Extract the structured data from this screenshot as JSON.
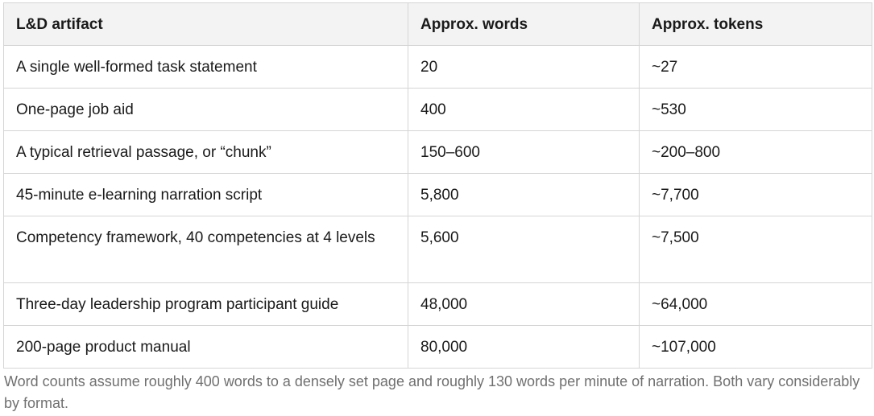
{
  "table": {
    "headers": [
      "L&D artifact",
      "Approx. words",
      "Approx. tokens"
    ],
    "rows": [
      [
        "A single well-formed task statement",
        "20",
        "~27"
      ],
      [
        "One-page job aid",
        "400",
        "~530"
      ],
      [
        "A typical retrieval passage, or “chunk”",
        "150–600",
        "~200–800"
      ],
      [
        "45-minute e-learning narration script",
        "5,800",
        "~7,700"
      ],
      [
        "Competency framework, 40 competencies at 4 levels",
        "5,600",
        "~7,500"
      ],
      [
        "Three-day leadership program participant guide",
        "48,000",
        "~64,000"
      ],
      [
        "200-page product manual",
        "80,000",
        "~107,000"
      ]
    ]
  },
  "footnote": "Word counts assume roughly 400 words to a densely set page and roughly 130 words per minute of narration. Both vary considerably by format."
}
